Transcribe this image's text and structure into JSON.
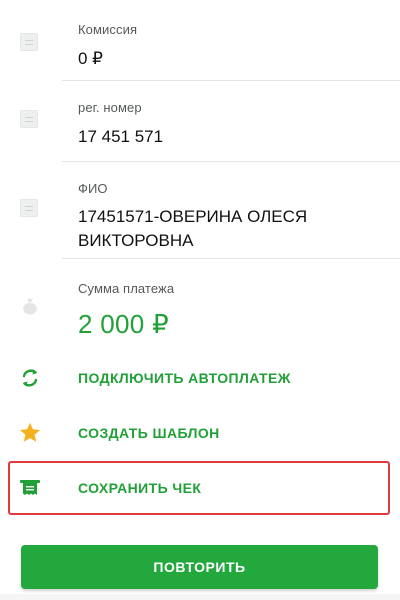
{
  "details": [
    {
      "label": "Комиссия",
      "value": "0 ₽",
      "icon": "document-icon"
    },
    {
      "label": "рег. номер",
      "value": "17 451 571",
      "icon": "document-icon"
    },
    {
      "label": "ФИО",
      "value": "17451571-ОВЕРИНА ОЛЕСЯ ВИКТОРОВНА",
      "icon": "document-icon"
    }
  ],
  "amount": {
    "label": "Сумма платежа",
    "value": "2 000 ₽",
    "icon": "money-bag-icon"
  },
  "actions": [
    {
      "label": "ПОДКЛЮЧИТЬ АВТОПЛАТЕЖ",
      "icon": "autopay-refresh-icon"
    },
    {
      "label": "СОЗДАТЬ ШАБЛОН",
      "icon": "star-icon"
    },
    {
      "label": "СОХРАНИТЬ ЧЕК",
      "icon": "receipt-icon"
    }
  ],
  "repeat_button": {
    "label": "ПОВТОРИТЬ"
  },
  "colors": {
    "accent_green": "#21a038",
    "button_green": "#22a83d",
    "star_yellow": "#f5b21e",
    "highlight_red": "#e0393e",
    "divider": "#e4e6e5"
  }
}
